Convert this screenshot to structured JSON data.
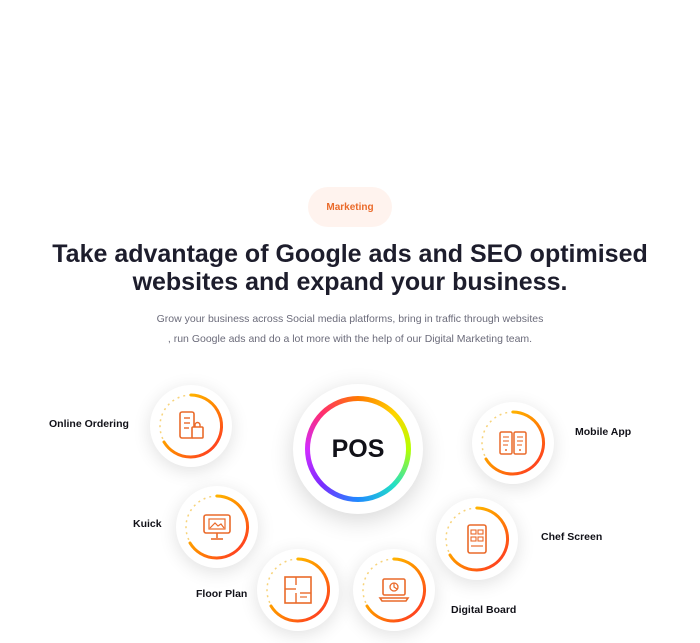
{
  "section": {
    "badge": "Marketing",
    "title_line1": "Take advantage of Google ads and SEO optimised",
    "title_line2": "websites and expand your business.",
    "subtitle_line1": "Grow your business across Social media platforms, bring in traffic through websites",
    "subtitle_line2": ", run Google ads and do a lot more with the help of our Digital Marketing team."
  },
  "center": {
    "label": "POS"
  },
  "modules": [
    {
      "label": "Online Ordering",
      "icon": "phone-shopping-bag-icon"
    },
    {
      "label": "Kuick",
      "icon": "kiosk-monitor-icon"
    },
    {
      "label": "Floor Plan",
      "icon": "floor-plan-icon"
    },
    {
      "label": "Digital Board",
      "icon": "laptop-menu-icon"
    },
    {
      "label": "Chef Screen",
      "icon": "tablet-order-icon"
    },
    {
      "label": "Mobile App",
      "icon": "mobile-app-icon"
    }
  ],
  "colors": {
    "accent": "#ea6a2a",
    "ring_gradient_start": "#ffd400",
    "ring_gradient_end": "#ff2a2a",
    "badge_bg": "#fff3ee"
  }
}
